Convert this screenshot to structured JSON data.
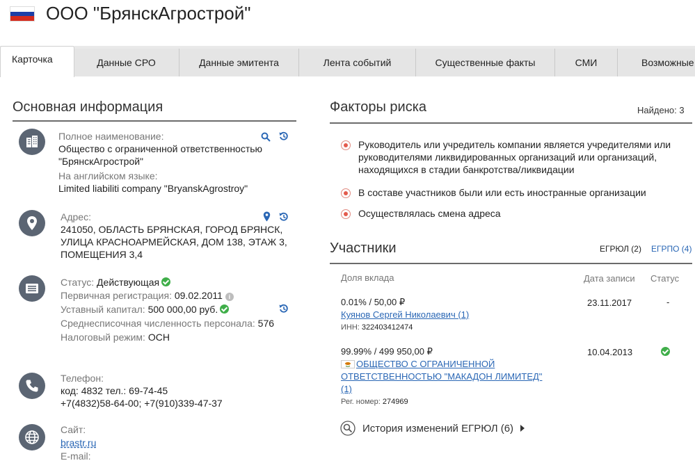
{
  "company": {
    "name": "ООО \"БрянскАгрострой\""
  },
  "tabs": [
    {
      "label": "Карточка"
    },
    {
      "label": "Данные СРО"
    },
    {
      "label": "Данные эмитента"
    },
    {
      "label": "Лента событий"
    },
    {
      "label": "Существенные факты"
    },
    {
      "label": "СМИ"
    },
    {
      "label": "Возможные"
    }
  ],
  "main_info": {
    "title": "Основная информация",
    "full_name_label": "Полное наименование:",
    "full_name_line1": "Общество с ограниченной ответственностью",
    "full_name_line2": "\"БрянскАгрострой\"",
    "english_label": "На английском языке:",
    "english_value": "Limited liabiliti company \"BryanskAgrostroy\"",
    "address_label": "Адрес:",
    "address_line1": "241050, ОБЛАСТЬ БРЯНСКАЯ, ГОРОД БРЯНСК,",
    "address_line2": "УЛИЦА КРАСНОАРМЕЙСКАЯ, ДОМ 138, ЭТАЖ 3,",
    "address_line3": "ПОМЕЩЕНИЯ 3,4",
    "status_label": "Статус:",
    "status_value": "Действующая",
    "reg_label": "Первичная регистрация:",
    "reg_value": "09.02.2011",
    "capital_label": "Уставный капитал:",
    "capital_value": "500 000,00 руб.",
    "staff_label": "Среднесписочная численность персонала:",
    "staff_value": "576",
    "tax_label": "Налоговый режим:",
    "tax_value": "ОСН",
    "phone_label": "Телефон:",
    "phone_line1": "код: 4832 тел.: 69-74-45",
    "phone_line2": "+7(4832)58-64-00; +7(910)339-47-37",
    "site_label": "Сайт:",
    "site_value": "brastr.ru",
    "email_label": "E-mail:"
  },
  "risk": {
    "title": "Факторы риска",
    "found": "Найдено: 3",
    "items": [
      {
        "line1": "Руководитель или учредитель компании является учредителями или",
        "line2": "руководителями ликвидированных организаций или организаций,",
        "line3": "находящихся в стадии банкротства/ликвидации"
      },
      {
        "line1": "В составе участников были или есть иностранные организации"
      },
      {
        "line1": "Осуществлялась смена адреса"
      }
    ]
  },
  "participants": {
    "title": "Участники",
    "egrul_tab": "ЕГРЮЛ (2)",
    "egrpo_tab": "ЕГРПО (4)",
    "col_share": "Доля вклада",
    "col_date": "Дата записи",
    "col_status": "Статус",
    "rows": [
      {
        "share": "0.01% / 50,00 ₽",
        "name_line1": "Куянов Сергей Николаевич (1)",
        "id_label": "ИНН:",
        "id_value": "322403412474",
        "date": "23.11.2017",
        "status": "-"
      },
      {
        "share": "99.99% / 499 950,00 ₽",
        "name_line1": " ОБЩЕСТВО С ОГРАНИЧЕННОЙ",
        "name_line2": "ОТВЕТСТВЕННОСТЬЮ \"МАКАДОН ЛИМИТЕД\"",
        "name_line3": "(1)",
        "id_label": "Рег. номер:",
        "id_value": "274969",
        "date": "10.04.2013"
      }
    ],
    "history": "История изменений ЕГРЮЛ (6)"
  },
  "colors": {
    "icon_bg": "#5b6573",
    "link": "#2a67b5",
    "ok_green": "#3fae49",
    "risk_red": "#e35b4d"
  }
}
